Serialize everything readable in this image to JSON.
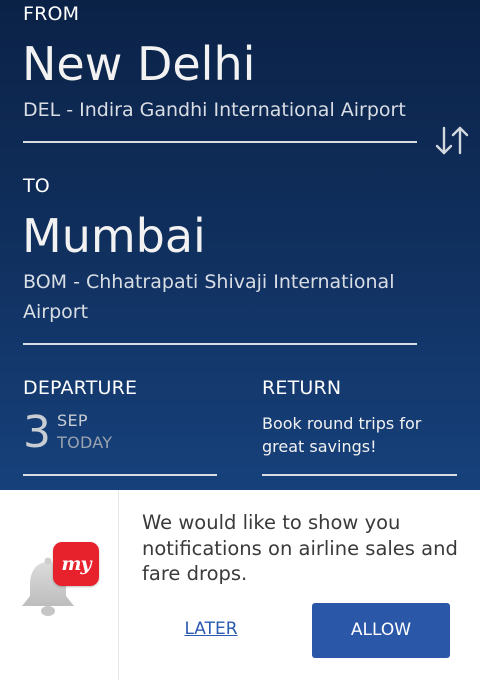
{
  "from": {
    "label": "FROM",
    "city": "New Delhi",
    "airport": "DEL - Indira Gandhi International Airport"
  },
  "to": {
    "label": "TO",
    "city": "Mumbai",
    "airport": "BOM - Chhatrapati Shivaji International Airport"
  },
  "departure": {
    "label": "DEPARTURE",
    "day": "3",
    "month": "SEP",
    "relative": "TODAY"
  },
  "return": {
    "label": "RETURN",
    "hint": "Book round trips for great savings!"
  },
  "notification": {
    "logo_text": "my",
    "message": "We would like to show you notifications on airline sales and fare drops.",
    "later_label": "LATER",
    "allow_label": "ALLOW"
  },
  "colors": {
    "background_top": "#0b2247",
    "background_bottom": "#1b4a86",
    "brand_red": "#e8222c",
    "allow_button": "#2a57a8",
    "later_link": "#2a5bb0"
  },
  "icons": {
    "swap": "swap-vertical-icon",
    "bell": "bell-icon"
  }
}
